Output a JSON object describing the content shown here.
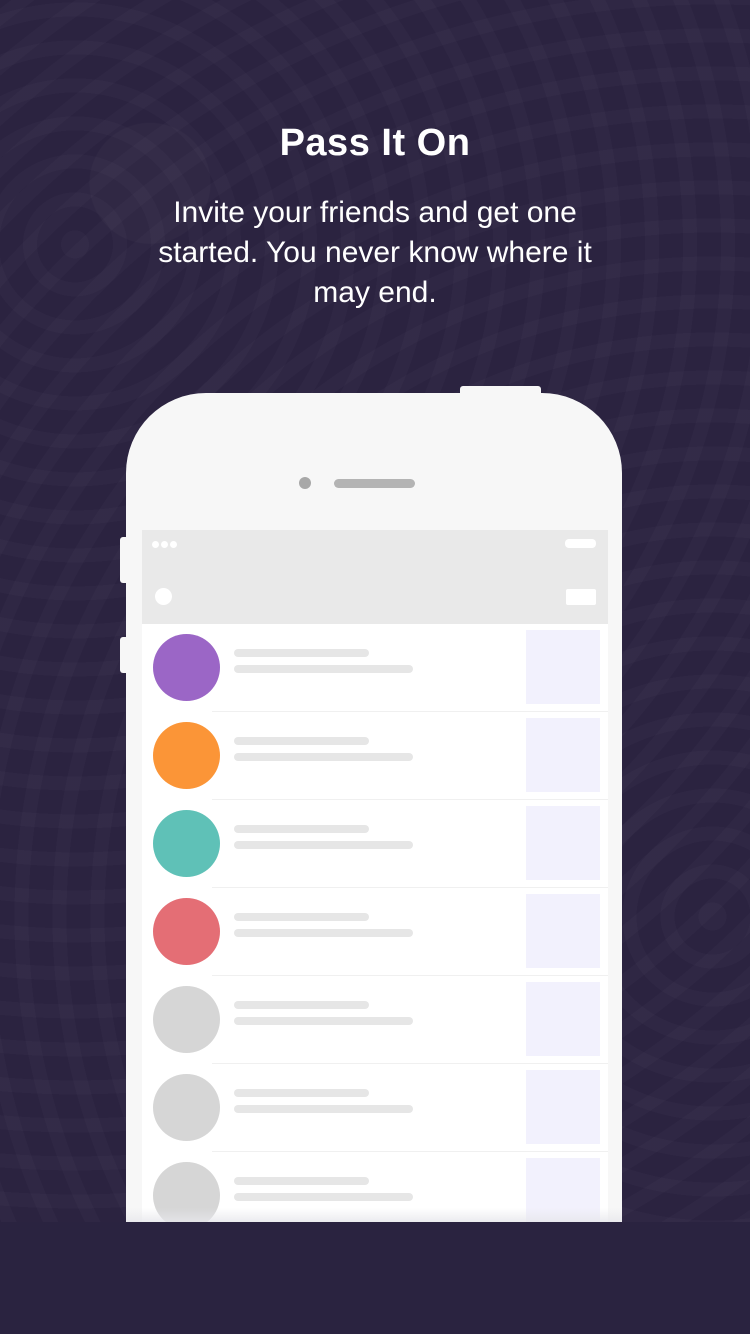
{
  "onboarding": {
    "title": "Pass It On",
    "subtitle": "Invite your friends and get one started. You never know where it may end."
  },
  "phone_mockup": {
    "list_items": [
      {
        "avatar_color": "#9b66c6"
      },
      {
        "avatar_color": "#fb9537"
      },
      {
        "avatar_color": "#5fc1b7"
      },
      {
        "avatar_color": "#e46e75"
      },
      {
        "avatar_color": "#d6d6d6"
      },
      {
        "avatar_color": "#d6d6d6"
      },
      {
        "avatar_color": "#d6d6d6"
      }
    ]
  },
  "colors": {
    "background": "#2b2340",
    "phone_body": "#f7f7f7",
    "header_bar": "#e9e9e9",
    "thumbnail": "#f2f1fd"
  }
}
